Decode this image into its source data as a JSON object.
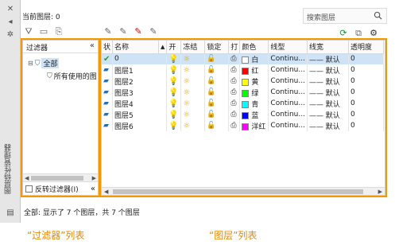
{
  "window": {
    "vertical_title": "图层特性管理器",
    "current_layer_label": "当前图层: 0",
    "search_placeholder": "搜索图层",
    "status_text": "全部: 显示了 7 个图层，共 7 个图层"
  },
  "filter_panel": {
    "title": "过滤器",
    "collapse_icon": "«",
    "tree": [
      {
        "label": "全部",
        "selected": true
      },
      {
        "label": "所有使用的图层",
        "selected": false
      }
    ],
    "invert_filter_label": "反转过滤器(I)"
  },
  "layer_table": {
    "columns": [
      "状",
      "名称",
      "",
      "开",
      "冻结",
      "锁定",
      "打",
      "颜色",
      "线型",
      "线宽",
      "透明度"
    ],
    "rows": [
      {
        "status": "current",
        "name": "0",
        "color_name": "白",
        "color_hex": "#ffffff",
        "linetype": "Continu...",
        "lineweight": "—— 默认",
        "transparency": "0"
      },
      {
        "status": "layer",
        "name": "图层1",
        "color_name": "红",
        "color_hex": "#ff0000",
        "linetype": "Continu...",
        "lineweight": "—— 默认",
        "transparency": "0"
      },
      {
        "status": "layer",
        "name": "图层2",
        "color_name": "黄",
        "color_hex": "#ffff00",
        "linetype": "Continu...",
        "lineweight": "—— 默认",
        "transparency": "0"
      },
      {
        "status": "layer",
        "name": "图层3",
        "color_name": "绿",
        "color_hex": "#00ff00",
        "linetype": "Continu...",
        "lineweight": "—— 默认",
        "transparency": "0"
      },
      {
        "status": "layer",
        "name": "图层4",
        "color_name": "青",
        "color_hex": "#00ffff",
        "linetype": "Continu...",
        "lineweight": "—— 默认",
        "transparency": "0"
      },
      {
        "status": "layer",
        "name": "图层5",
        "color_name": "蓝",
        "color_hex": "#0000ff",
        "linetype": "Continu...",
        "lineweight": "—— 默认",
        "transparency": "0"
      },
      {
        "status": "layer",
        "name": "图层6",
        "color_name": "洋红",
        "color_hex": "#ff00ff",
        "linetype": "Continu...",
        "lineweight": "—— 默认",
        "transparency": "0"
      }
    ]
  },
  "captions": {
    "left": "“过滤器”列表",
    "right": "“图层”列表"
  },
  "colors": {
    "accent": "#f39800",
    "selection": "#cfe3f7"
  },
  "icons": {
    "on": "lightbulb-icon",
    "freeze": "sun-icon",
    "lock": "unlock-icon",
    "plot": "printer-icon",
    "refresh": "refresh-icon",
    "settings": "gear-icon"
  }
}
